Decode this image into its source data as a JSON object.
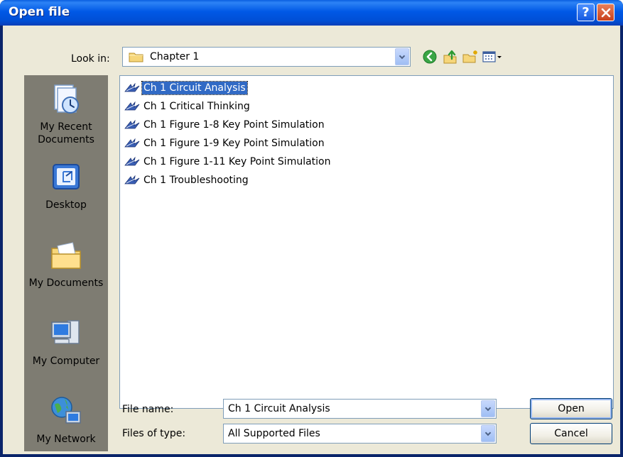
{
  "window": {
    "title": "Open file",
    "help_button": "?",
    "close_button": "✕"
  },
  "toolbar": {
    "look_in_label": "Look in:",
    "look_in_value": "Chapter 1",
    "icons": [
      "back-icon",
      "up-folder-icon",
      "new-folder-icon",
      "views-menu-icon"
    ]
  },
  "places": [
    {
      "label": "My Recent Documents",
      "line1": "My Recent",
      "line2": "Documents",
      "icon": "recent-documents-icon"
    },
    {
      "label": "Desktop",
      "line1": "Desktop",
      "line2": "",
      "icon": "desktop-icon"
    },
    {
      "label": "My Documents",
      "line1": "My Documents",
      "line2": "",
      "icon": "my-documents-icon"
    },
    {
      "label": "My Computer",
      "line1": "My Computer",
      "line2": "",
      "icon": "my-computer-icon"
    },
    {
      "label": "My Network",
      "line1": "My Network",
      "line2": "",
      "icon": "my-network-icon"
    }
  ],
  "files": [
    {
      "name": "Ch 1 Circuit Analysis",
      "selected": true
    },
    {
      "name": "Ch 1 Critical Thinking",
      "selected": false
    },
    {
      "name": "Ch 1 Figure 1-8 Key Point Simulation",
      "selected": false
    },
    {
      "name": "Ch 1 Figure 1-9 Key Point Simulation",
      "selected": false
    },
    {
      "name": "Ch 1 Figure 1-11 Key Point Simulation",
      "selected": false
    },
    {
      "name": "Ch 1 Troubleshooting",
      "selected": false
    }
  ],
  "form": {
    "file_name_label": "File name:",
    "file_name_value": "Ch 1 Circuit Analysis",
    "files_of_type_label": "Files of type:",
    "files_of_type_value": "All Supported Files"
  },
  "buttons": {
    "open": "Open",
    "cancel": "Cancel"
  },
  "colors": {
    "titlebar": "#0058e6",
    "selection": "#316ac5",
    "dialog_bg": "#ece9d8",
    "places_bar": "#7e7c72"
  }
}
